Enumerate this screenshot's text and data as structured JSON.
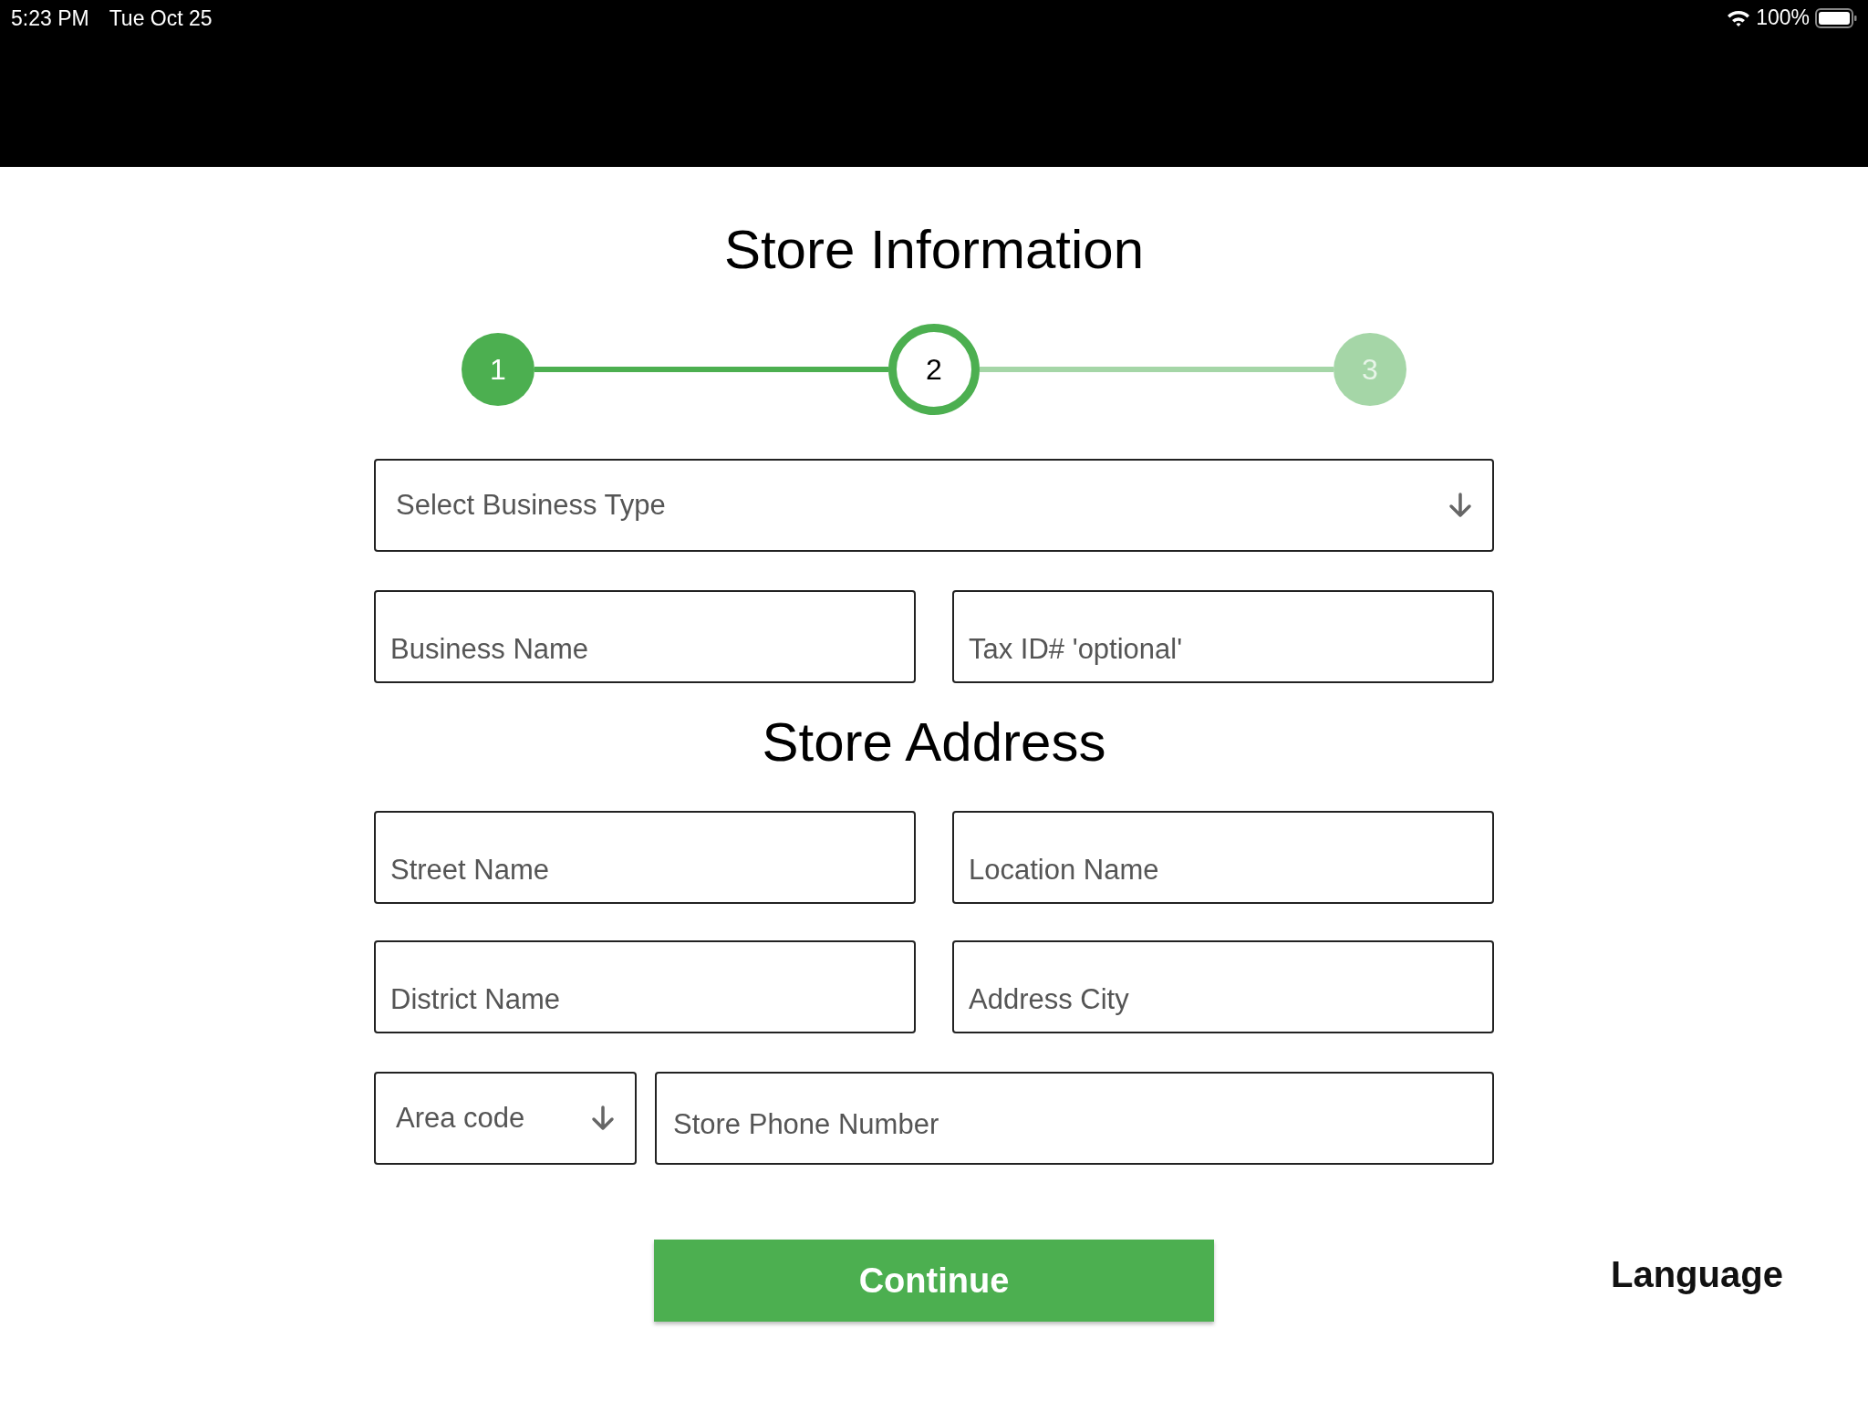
{
  "status_bar": {
    "time": "5:23 PM",
    "date": "Tue Oct 25",
    "battery": "100%"
  },
  "title": "Store Information",
  "steps": [
    {
      "label": "1",
      "kind": "done"
    },
    {
      "label": "2",
      "kind": "current"
    },
    {
      "label": "3",
      "kind": "todo"
    }
  ],
  "business_type": {
    "placeholder": "Select Business Type"
  },
  "business_fields": [
    {
      "placeholder": "Business Name"
    },
    {
      "placeholder": "Tax ID# 'optional'"
    }
  ],
  "address_title": "Store Address",
  "address_fields": [
    {
      "placeholder": "Street Name"
    },
    {
      "placeholder": "Location Name"
    },
    {
      "placeholder": "District Name"
    },
    {
      "placeholder": "Address City"
    }
  ],
  "area_code": {
    "placeholder": "Area code"
  },
  "phone": {
    "placeholder": "Store Phone Number"
  },
  "continue_button": "Continue",
  "language_button": "Language"
}
